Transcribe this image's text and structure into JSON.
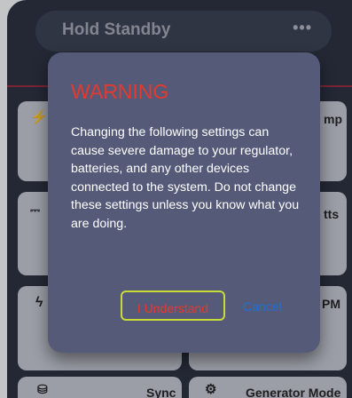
{
  "header": {
    "title": "Hold Standby",
    "more_label": "•••"
  },
  "tiles": [
    {
      "label": "mp",
      "icon": "bolt-circle-icon"
    },
    {
      "label": "tts",
      "icon": "dc-icon"
    },
    {
      "label": "PM",
      "icon": "bolt-icon"
    },
    {
      "label": "Sync",
      "icon": "database-icon"
    },
    {
      "label": "Generator Mode",
      "icon": "engine-icon"
    }
  ],
  "modal": {
    "title": "WARNING",
    "body": "Changing the following settings can cause severe damage to your regulator, batteries, and any other devices connected to the system. Do not change these settings unless you know what you are doing.",
    "confirm_label": "I Understand",
    "cancel_label": "Cancel"
  },
  "colors": {
    "warning": "#e5392e",
    "confirm_border": "#c7da3a",
    "cancel": "#1e6fd9",
    "modal_bg": "#555a78"
  }
}
